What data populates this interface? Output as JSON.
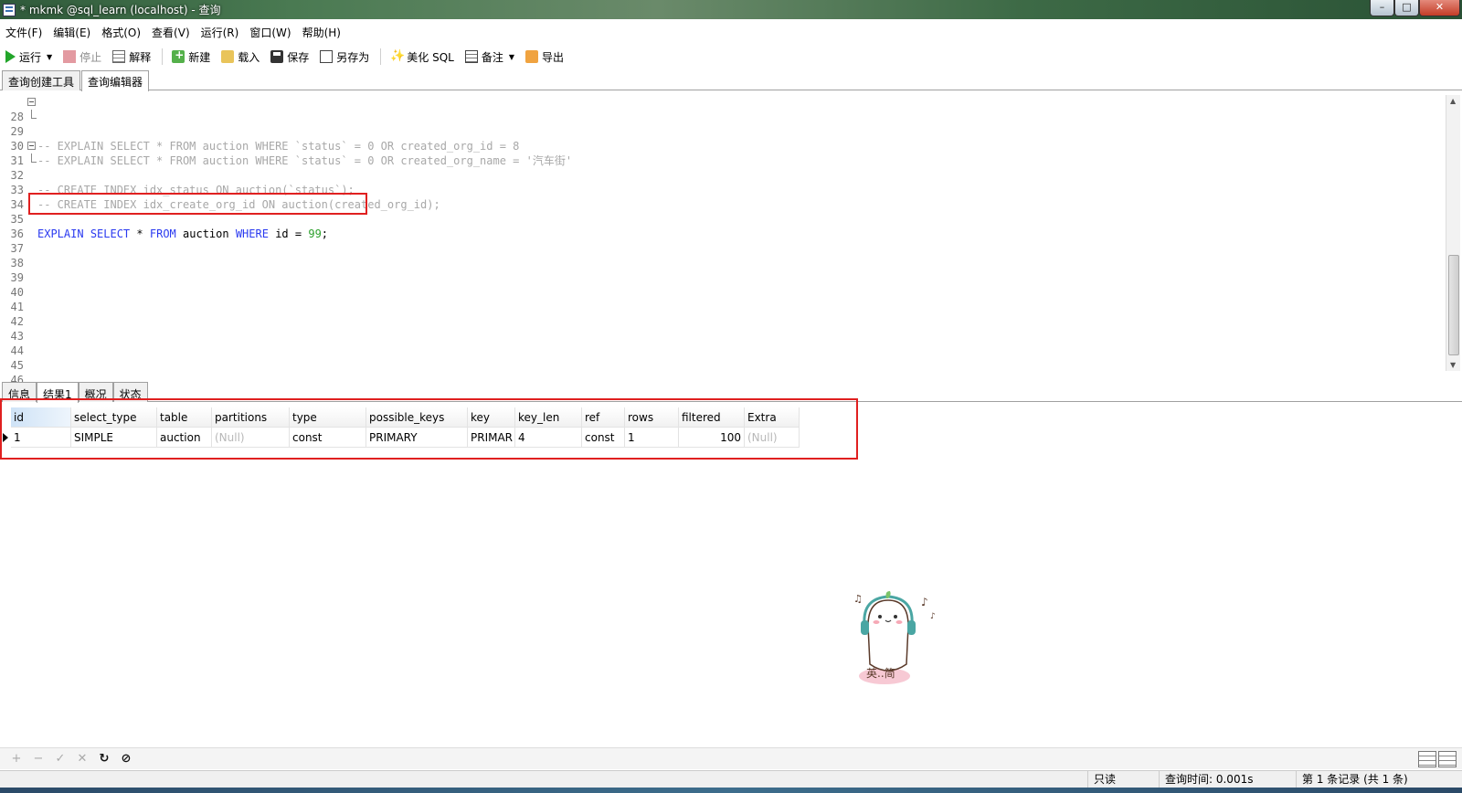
{
  "window": {
    "title": "* mkmk @sql_learn (localhost) - 查询",
    "buttons": {
      "minimize": "–",
      "maximize": "□",
      "close": "✕"
    }
  },
  "menu": [
    "文件(F)",
    "编辑(E)",
    "格式(O)",
    "查看(V)",
    "运行(R)",
    "窗口(W)",
    "帮助(H)"
  ],
  "toolbar": {
    "run": "运行",
    "stop": "停止",
    "explain": "解释",
    "new": "新建",
    "load": "载入",
    "save": "保存",
    "save_as": "另存为",
    "beautify": "美化 SQL",
    "note": "备注",
    "export": "导出"
  },
  "editor_tabs": [
    "查询创建工具",
    "查询编辑器"
  ],
  "editor": {
    "lines": [
      {
        "n": "28",
        "text": "-- EXPLAIN SELECT * FROM auction WHERE `status` = 0 OR created_org_id = 8"
      },
      {
        "n": "29",
        "text": "-- EXPLAIN SELECT * FROM auction WHERE `status` = 0 OR created_org_name = '汽车街'"
      },
      {
        "n": "30",
        "text": ""
      },
      {
        "n": "31",
        "text": "-- CREATE INDEX idx_status ON auction(`status`);"
      },
      {
        "n": "32",
        "text": "-- CREATE INDEX idx_create_org_id ON auction(created_org_id);"
      },
      {
        "n": "33",
        "text": ""
      },
      {
        "n": "34",
        "text": ""
      },
      {
        "n": "35",
        "text": ""
      },
      {
        "n": "36",
        "text": ""
      },
      {
        "n": "37",
        "text": ""
      },
      {
        "n": "38",
        "text": ""
      },
      {
        "n": "39",
        "text": ""
      },
      {
        "n": "40",
        "text": ""
      },
      {
        "n": "41",
        "text": ""
      },
      {
        "n": "42",
        "text": ""
      },
      {
        "n": "43",
        "text": ""
      },
      {
        "n": "44",
        "text": ""
      },
      {
        "n": "45",
        "text": ""
      },
      {
        "n": "46",
        "text": ""
      }
    ],
    "highlighted_statement": {
      "kw1": "EXPLAIN",
      "kw2": "SELECT",
      "star": "*",
      "kw3": "FROM",
      "table": "auction",
      "kw4": "WHERE",
      "col": "id",
      "op": "=",
      "num": "99",
      "end": ";"
    }
  },
  "result_tabs": [
    "信息",
    "结果1",
    "概况",
    "状态"
  ],
  "result": {
    "columns": [
      "id",
      "select_type",
      "table",
      "partitions",
      "type",
      "possible_keys",
      "key",
      "key_len",
      "ref",
      "rows",
      "filtered",
      "Extra"
    ],
    "rows": [
      [
        "1",
        "SIMPLE",
        "auction",
        "(Null)",
        "const",
        "PRIMARY",
        "PRIMAR",
        "4",
        "const",
        "1",
        "100",
        "(Null)"
      ]
    ]
  },
  "grid_toolbar": [
    "+",
    "−",
    "✓",
    "✕",
    "↻",
    "⊘"
  ],
  "status": {
    "readonly": "只读",
    "query_time": "查询时间: 0.001s",
    "records": "第 1 条记录 (共 1 条)"
  },
  "colors": {
    "keyword": "#2a3af0",
    "comment": "#a8a8a8",
    "number": "#2ca02c",
    "highlight_border": "#e02020"
  }
}
